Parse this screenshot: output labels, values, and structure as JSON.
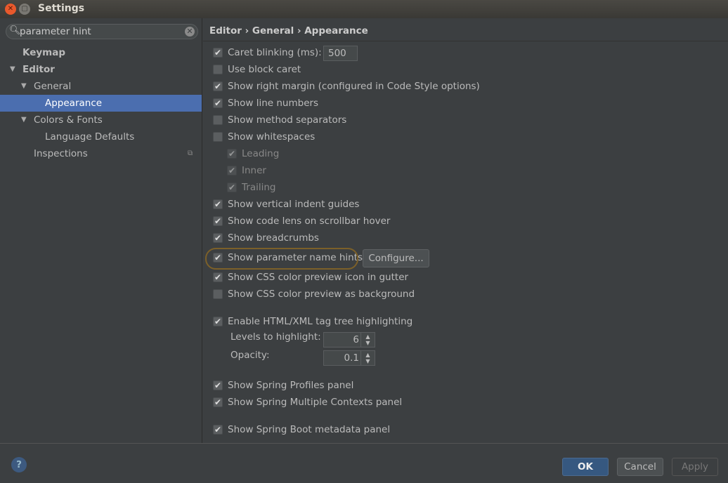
{
  "window": {
    "title": "Settings"
  },
  "search": {
    "value": "parameter hint"
  },
  "tree": [
    {
      "label": "Keymap",
      "bold": true
    },
    {
      "label": "Editor",
      "bold": true,
      "expanded": true
    },
    {
      "label": "General",
      "expanded": true
    },
    {
      "label": "Appearance",
      "selected": true
    },
    {
      "label": "Colors & Fonts",
      "expanded": true
    },
    {
      "label": "Language Defaults"
    },
    {
      "label": "Inspections"
    }
  ],
  "breadcrumb": "Editor › General › Appearance",
  "options": [
    {
      "label": "Caret blinking (ms):",
      "checked": true
    },
    {
      "label": "Use block caret",
      "checked": false
    },
    {
      "label": "Show right margin (configured in Code Style options)",
      "checked": true
    },
    {
      "label": "Show line numbers",
      "checked": true
    },
    {
      "label": "Show method separators",
      "checked": false
    },
    {
      "label": "Show whitespaces",
      "checked": false
    },
    {
      "label": "Leading",
      "checked": true,
      "disabled": true
    },
    {
      "label": "Inner",
      "checked": true,
      "disabled": true
    },
    {
      "label": "Trailing",
      "checked": true,
      "disabled": true
    },
    {
      "label": "Show vertical indent guides",
      "checked": true
    },
    {
      "label": "Show code lens on scrollbar hover",
      "checked": true
    },
    {
      "label": "Show breadcrumbs",
      "checked": true
    },
    {
      "label": "Show parameter name hints",
      "checked": true
    },
    {
      "label": "Show CSS color preview icon in gutter",
      "checked": true
    },
    {
      "label": "Show CSS color preview as background",
      "checked": false
    },
    {
      "label": "Enable HTML/XML tag tree highlighting",
      "checked": true
    },
    {
      "label": "Show Spring Profiles panel",
      "checked": true
    },
    {
      "label": "Show Spring Multiple Contexts panel",
      "checked": true
    },
    {
      "label": "Show Spring Boot metadata panel",
      "checked": true
    }
  ],
  "caret_blinking_value": "500",
  "configure_label": "Configure...",
  "levels": {
    "label": "Levels to highlight:",
    "value": "6"
  },
  "opacity": {
    "label": "Opacity:",
    "value": "0.1"
  },
  "footer": {
    "ok": "OK",
    "cancel": "Cancel",
    "apply": "Apply",
    "help": "?"
  }
}
